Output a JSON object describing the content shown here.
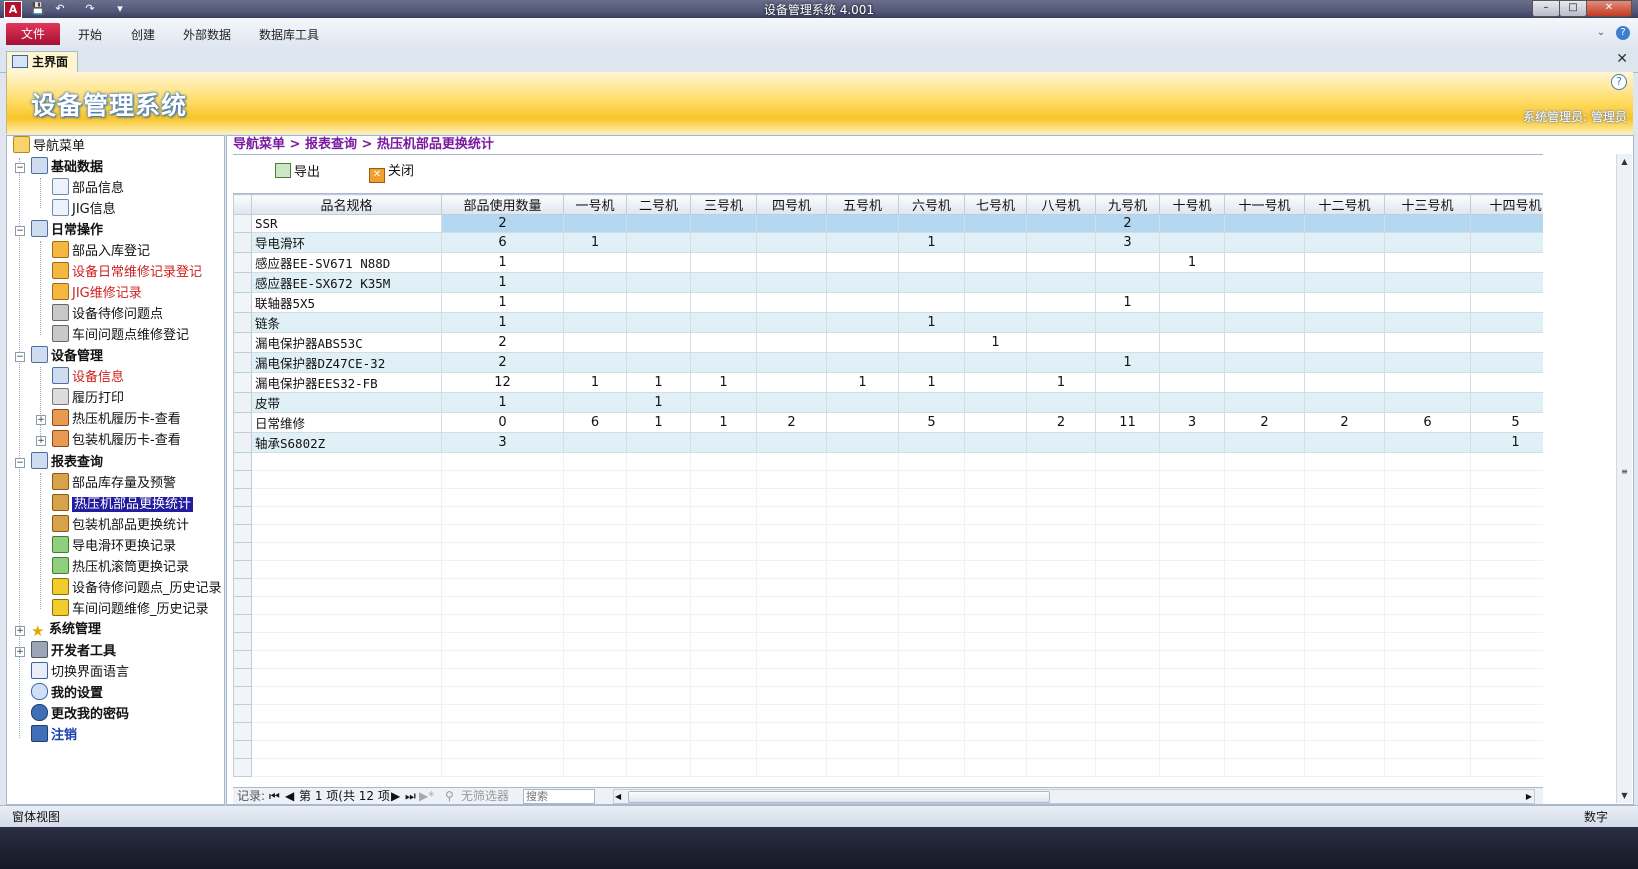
{
  "app": {
    "title": "设备管理系统 4.001",
    "icon_letter": "A",
    "quick_access": [
      "save-icon",
      "undo-icon",
      "redo-icon",
      "customize-icon"
    ],
    "window_buttons": [
      "–",
      "□",
      "✕"
    ]
  },
  "ribbon": {
    "tabs": [
      "文件",
      "开始",
      "创建",
      "外部数据",
      "数据库工具"
    ]
  },
  "doc_tab": {
    "label": "主界面",
    "close": "✕"
  },
  "banner": {
    "title": "设备管理系统",
    "user": "系统管理员: 管理员",
    "help": "?"
  },
  "nav": {
    "root": "导航菜单",
    "groups": {
      "basic": {
        "label": "基础数据",
        "items": [
          "部品信息",
          "JIG信息"
        ]
      },
      "daily": {
        "label": "日常操作",
        "items": [
          "部品入库登记",
          "设备日常维修记录登记",
          "JIG维修记录",
          "设备待修问题点",
          "车间问题点维修登记"
        ]
      },
      "equipment": {
        "label": "设备管理",
        "items": [
          "设备信息",
          "履历打印",
          "热压机履历卡-查看",
          "包装机履历卡-查看"
        ]
      },
      "reports": {
        "label": "报表查询",
        "items": [
          "部品库存量及预警",
          "热压机部品更换统计",
          "包装机部品更换统计",
          "导电滑环更换记录",
          "热压机滚筒更换记录",
          "设备待修问题点_历史记录",
          "车间问题维修_历史记录"
        ]
      },
      "system": {
        "label": "系统管理"
      },
      "dev": {
        "label": "开发者工具"
      }
    },
    "leaves": {
      "lang": "切换界面语言",
      "settings": "我的设置",
      "password": "更改我的密码",
      "logout": "注销"
    }
  },
  "main": {
    "breadcrumb": "导航菜单 > 报表查询 > 热压机部品更换统计",
    "toolbar": {
      "export": "导出",
      "close": "关闭"
    },
    "columns": [
      "品名规格",
      "部品使用数量",
      "一号机",
      "二号机",
      "三号机",
      "四号机",
      "五号机",
      "六号机",
      "七号机",
      "八号机",
      "九号机",
      "十号机",
      "十一号机",
      "十二号机",
      "十三号机",
      "十四号机"
    ],
    "rows": [
      [
        "SSR",
        "2",
        "",
        "",
        "",
        "",
        "",
        "",
        "",
        "",
        "2",
        "",
        "",
        "",
        "",
        ""
      ],
      [
        "导电滑环",
        "6",
        "1",
        "",
        "",
        "",
        "",
        "1",
        "",
        "",
        "3",
        "",
        "",
        "",
        "",
        ""
      ],
      [
        "感应器EE-SV671 N88D",
        "1",
        "",
        "",
        "",
        "",
        "",
        "",
        "",
        "",
        "",
        "1",
        "",
        "",
        "",
        ""
      ],
      [
        "感应器EE-SX672 K35M",
        "1",
        "",
        "",
        "",
        "",
        "",
        "",
        "",
        "",
        "",
        "",
        "",
        "",
        "",
        ""
      ],
      [
        "联轴器5X5",
        "1",
        "",
        "",
        "",
        "",
        "",
        "",
        "",
        "",
        "1",
        "",
        "",
        "",
        "",
        ""
      ],
      [
        "链条",
        "1",
        "",
        "",
        "",
        "",
        "",
        "1",
        "",
        "",
        "",
        "",
        "",
        "",
        "",
        ""
      ],
      [
        "漏电保护器ABS53C",
        "2",
        "",
        "",
        "",
        "",
        "",
        "",
        "1",
        "",
        "",
        "",
        "",
        "",
        "",
        ""
      ],
      [
        "漏电保护器DZ47CE-32",
        "2",
        "",
        "",
        "",
        "",
        "",
        "",
        "",
        "",
        "1",
        "",
        "",
        "",
        "",
        ""
      ],
      [
        "漏电保护器EES32-FB",
        "12",
        "1",
        "1",
        "1",
        "",
        "1",
        "1",
        "",
        "1",
        "",
        "",
        "",
        "",
        "",
        ""
      ],
      [
        "皮带",
        "1",
        "",
        "1",
        "",
        "",
        "",
        "",
        "",
        "",
        "",
        "",
        "",
        "",
        "",
        ""
      ],
      [
        "日常维修",
        "0",
        "6",
        "1",
        "1",
        "2",
        "",
        "5",
        "",
        "2",
        "11",
        "3",
        "2",
        "2",
        "6",
        "5"
      ],
      [
        "轴承S6802Z",
        "3",
        "",
        "",
        "",
        "",
        "",
        "",
        "",
        "",
        "",
        "",
        "",
        "",
        "",
        "1"
      ]
    ],
    "record_nav": {
      "label": "记录:",
      "position": "第 1 项(共 12 项",
      "filter": "无筛选器",
      "search_placeholder": "搜索"
    }
  },
  "status": {
    "left": "窗体视图",
    "right": "数字"
  },
  "colors": {
    "accent": "#b3102a",
    "banner": "#f7c52a",
    "selection": "#231c9e",
    "breadcrumb": "#7a1aa0",
    "alt_row": "#dff0f7",
    "current_row": "#b5d8f2"
  }
}
